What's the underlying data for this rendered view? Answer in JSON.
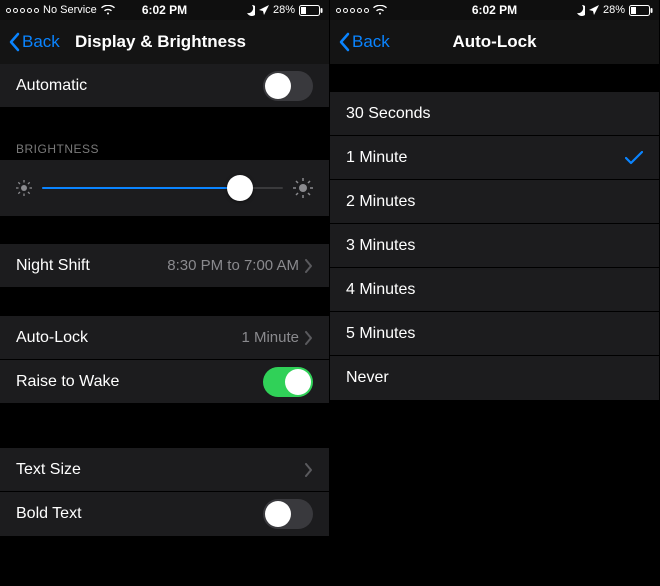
{
  "status": {
    "carrier": "No Service",
    "time": "6:02 PM",
    "battery_pct": "28%"
  },
  "left": {
    "back": "Back",
    "title": "Display & Brightness",
    "automatic": {
      "label": "Automatic",
      "on": false
    },
    "brightness_header": "BRIGHTNESS",
    "brightness_value": 82,
    "night_shift": {
      "label": "Night Shift",
      "detail": "8:30 PM to 7:00 AM"
    },
    "auto_lock": {
      "label": "Auto-Lock",
      "detail": "1 Minute"
    },
    "raise_to_wake": {
      "label": "Raise to Wake",
      "on": true
    },
    "text_size": {
      "label": "Text Size"
    },
    "bold_text": {
      "label": "Bold Text",
      "on": false
    }
  },
  "right": {
    "back": "Back",
    "title": "Auto-Lock",
    "options": [
      "30 Seconds",
      "1 Minute",
      "2 Minutes",
      "3 Minutes",
      "4 Minutes",
      "5 Minutes",
      "Never"
    ],
    "selected": "1 Minute"
  }
}
